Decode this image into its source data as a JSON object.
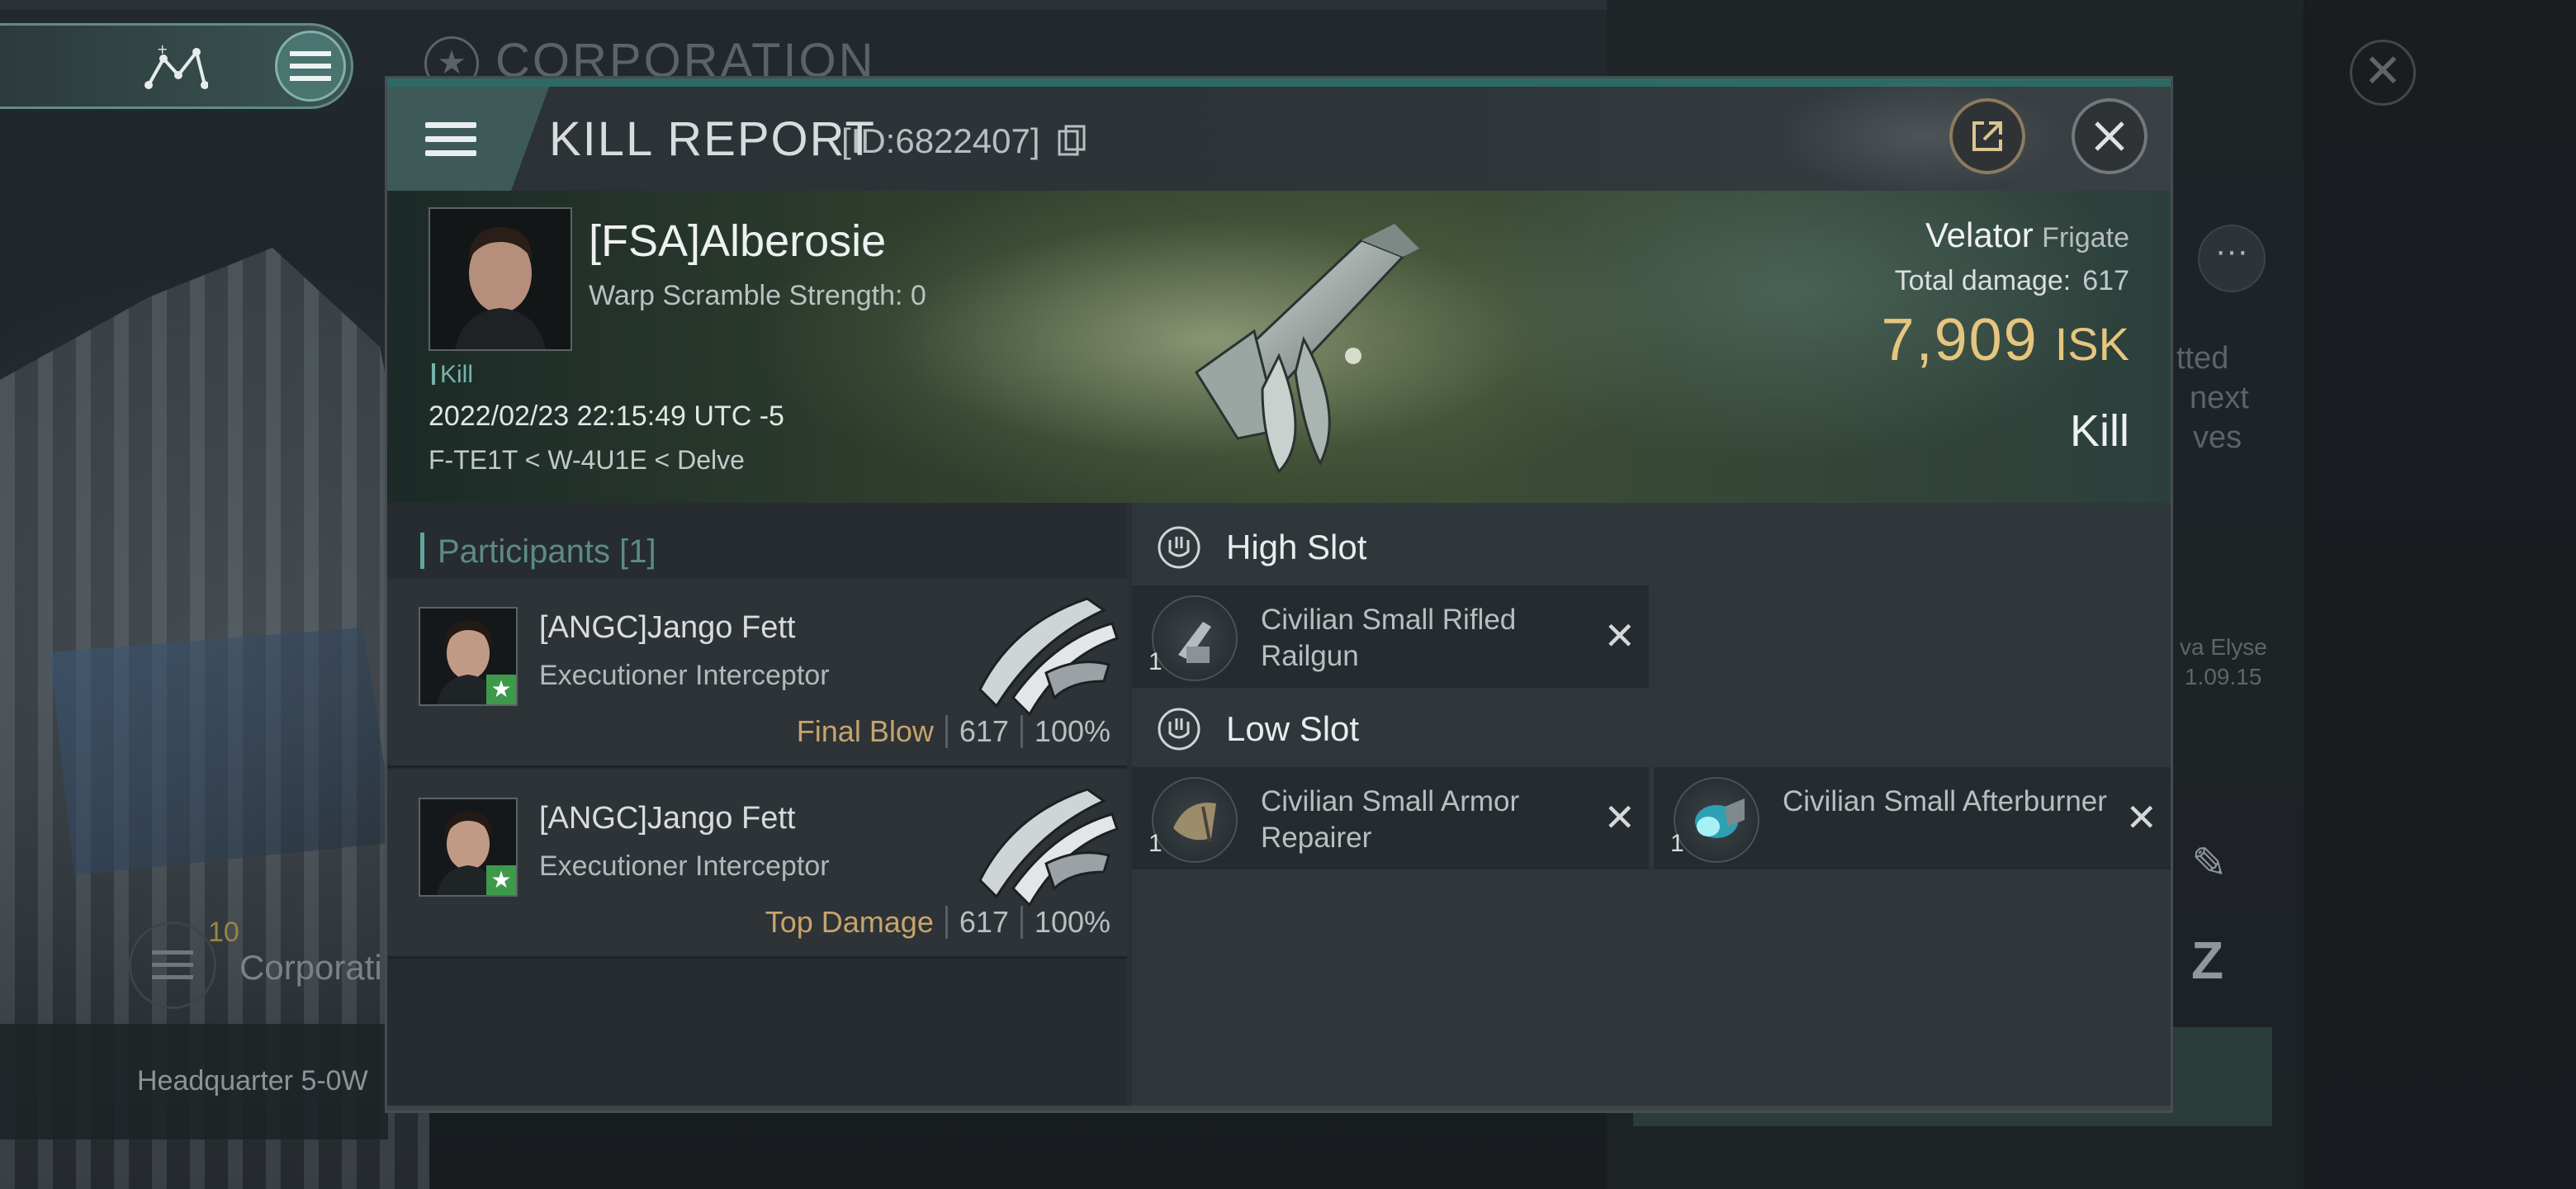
{
  "background": {
    "corporation_title": "CORPORATION",
    "side_text_1": "tted",
    "side_text_2": "next",
    "side_text_3": "ves",
    "side_name": "va Elyse",
    "side_date": "1.09.15",
    "corp_count": "10",
    "corp_label": "Corporati",
    "hq_label": "Headquarter 5-0W"
  },
  "kill_report": {
    "title": "KILL REPORT",
    "id_text": "[ID:6822407]",
    "victim": {
      "name": "[FSA]Alberosie",
      "warp_scramble": "Warp Scramble Strength: 0",
      "kill_tag": "Kill",
      "datetime": "2022/02/23 22:15:49 UTC -5",
      "location": "F-TE1T < W-4U1E < Delve"
    },
    "ship": {
      "name": "Velator",
      "class": "Frigate",
      "total_damage_label": "Total damage:",
      "total_damage_value": "617",
      "isk_value": "7,909",
      "isk_unit": "ISK",
      "result": "Kill"
    },
    "participants": {
      "header": "Participants [1]",
      "rows": [
        {
          "name": "[ANGC]Jango Fett",
          "ship": "Executioner Interceptor",
          "role": "Final Blow",
          "damage": "617",
          "percent": "100%"
        },
        {
          "name": "[ANGC]Jango Fett",
          "ship": "Executioner Interceptor",
          "role": "Top Damage",
          "damage": "617",
          "percent": "100%"
        }
      ]
    },
    "slots": {
      "high": {
        "title": "High Slot",
        "modules": [
          {
            "name": "Civilian Small Rifled Railgun",
            "qty": "1"
          }
        ]
      },
      "low": {
        "title": "Low Slot",
        "modules": [
          {
            "name": "Civilian Small Armor Repairer",
            "qty": "1"
          },
          {
            "name": "Civilian Small Afterburner",
            "qty": "1"
          }
        ]
      }
    }
  },
  "icons": {
    "map": "map-network-icon",
    "menu": "hamburger-menu-icon",
    "copy": "copy-icon",
    "share": "share-external-icon",
    "close": "close-icon",
    "slot": "slot-shield-icon",
    "remove": "remove-x-icon"
  },
  "colors": {
    "accent": "#5fa7a0",
    "isk": "#e6c57f",
    "role": "#c7a46a",
    "star": "#3c9a4a"
  }
}
